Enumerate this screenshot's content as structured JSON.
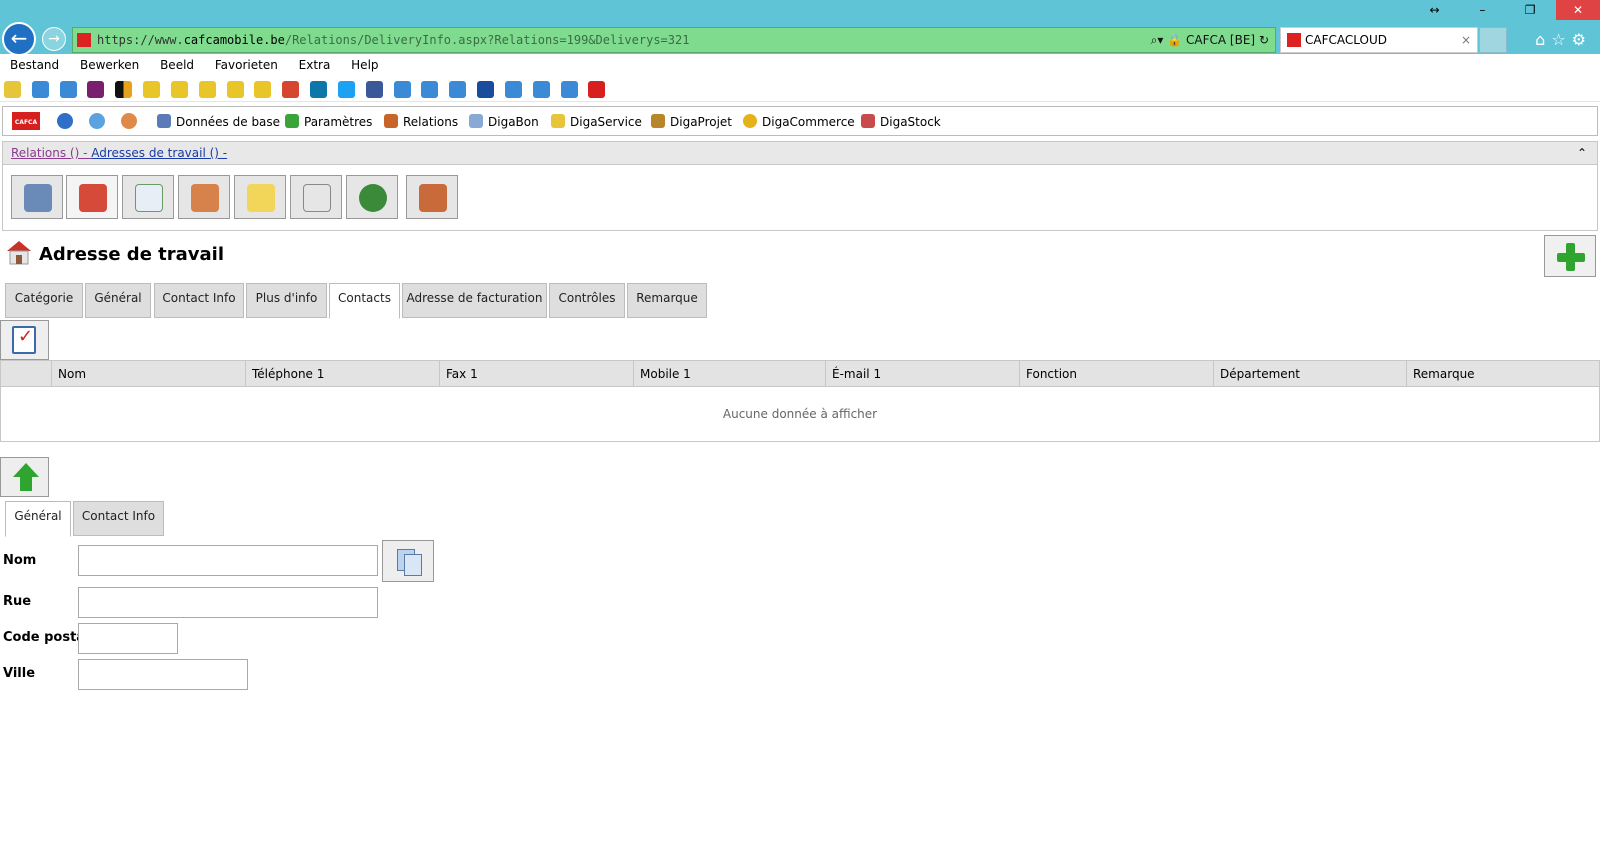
{
  "browser": {
    "url_scheme": "https://www.",
    "url_host": "cafcamobile.be",
    "url_path": "/Relations/DeliveryInfo.aspx?Relations=199&Deliverys=321",
    "site_identity": "CAFCA [BE]",
    "tab_title": "CAFCACLOUD",
    "tab_close": "×"
  },
  "menu": [
    "Bestand",
    "Bewerken",
    "Beeld",
    "Favorieten",
    "Extra",
    "Help"
  ],
  "appmenu": {
    "items": [
      "Données de base",
      "Paramètres",
      "Relations",
      "DigaBon",
      "DigaService",
      "DigaProjet",
      "DigaCommerce",
      "DigaStock"
    ]
  },
  "breadcrumb": {
    "part1": "Relations () - ",
    "part2": "Adresses de travail () -",
    "collapse": "⌃"
  },
  "page": {
    "title": "Adresse de travail"
  },
  "tabs": {
    "items": [
      "Catégorie",
      "Général",
      "Contact Info",
      "Plus d'info",
      "Contacts",
      "Adresse de facturation",
      "Contrôles",
      "Remarque"
    ],
    "active": "Contacts"
  },
  "grid": {
    "columns": [
      "Nom",
      "Téléphone 1",
      "Fax 1",
      "Mobile 1",
      "É-mail 1",
      "Fonction",
      "Département",
      "Remarque"
    ],
    "empty_text": "Aucune donnée à afficher"
  },
  "subtabs": {
    "items": [
      "Général",
      "Contact Info"
    ],
    "active": "Général"
  },
  "form": {
    "labels": {
      "nom": "Nom",
      "rue": "Rue",
      "code_postal": "Code postal",
      "ville": "Ville"
    },
    "values": {
      "nom": "",
      "rue": "",
      "code_postal": "",
      "ville": ""
    }
  },
  "colors": {
    "titlebar": "#5fc4d6",
    "addressbar": "#7fdc8f",
    "accent_green": "#2fa52f",
    "brand_red": "#d62020"
  }
}
